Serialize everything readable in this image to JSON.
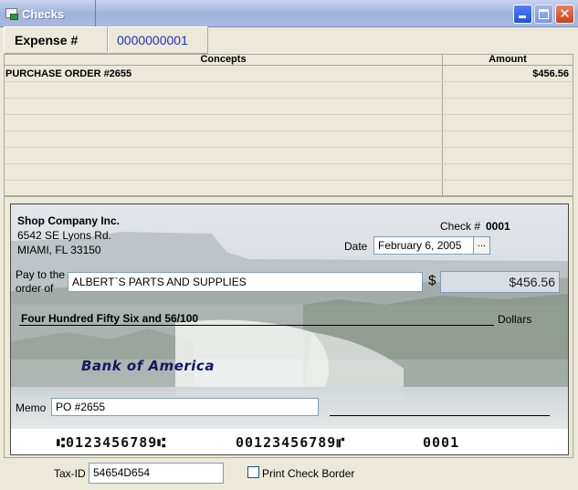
{
  "window": {
    "title": "Checks",
    "minimize_icon": "minimize-icon",
    "maximize_icon": "maximize-icon",
    "close_icon": "close-icon"
  },
  "expense": {
    "label": "Expense #",
    "number": "0000000001"
  },
  "grid": {
    "columns": [
      "Concepts",
      "Amount"
    ],
    "rows": [
      {
        "concept": "PURCHASE ORDER #2655",
        "amount": "$456.56"
      },
      {
        "concept": "",
        "amount": ""
      },
      {
        "concept": "",
        "amount": ""
      },
      {
        "concept": "",
        "amount": ""
      },
      {
        "concept": "",
        "amount": ""
      },
      {
        "concept": "",
        "amount": ""
      },
      {
        "concept": "",
        "amount": ""
      },
      {
        "concept": "",
        "amount": ""
      }
    ]
  },
  "check": {
    "company_name": "Shop Company Inc.",
    "address_line1": "6542 SE Lyons Rd.",
    "address_line2": "MIAMI, FL 33150",
    "check_no_label": "Check #",
    "check_no": "0001",
    "date_label": "Date",
    "date_value": "February 6, 2005",
    "date_button": "...",
    "pay_to_label": "Pay to the order of",
    "payee": "ALBERT`S PARTS AND SUPPLIES",
    "currency_symbol": "$",
    "amount": "$456.56",
    "amount_words": "Four Hundred Fifty Six and 56/100",
    "dollars_label": "Dollars",
    "bank_name": "Bank of America",
    "memo_label": "Memo",
    "memo_value": "PO #2655",
    "micr_routing": "⑆0123456789⑆",
    "micr_account": "00123456789⑈",
    "micr_check_no": "0001"
  },
  "footer": {
    "tax_id_label": "Tax-ID",
    "tax_id_value": "54654D654",
    "print_border_label": "Print Check Border",
    "print_border_checked": false
  },
  "colors": {
    "title_bar": "#9fb3dd",
    "window_bg": "#ece9d8",
    "expense_number": "#1d31c8",
    "bank_name": "#121a62"
  }
}
